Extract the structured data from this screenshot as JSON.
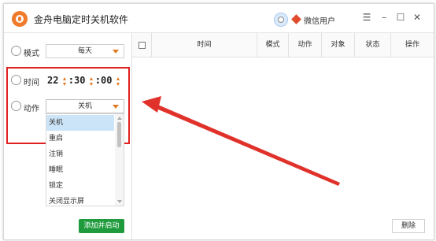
{
  "window": {
    "title": "金舟电脑定时关机软件",
    "user_name": "微信用户",
    "controls": {
      "menu": "☰",
      "minimize": "–",
      "maximize": "☐",
      "close": "✕"
    }
  },
  "left_panel": {
    "mode": {
      "label": "模式",
      "value": "每天"
    },
    "time": {
      "label": "时间",
      "hour": "22",
      "minute": "30",
      "second": "00"
    },
    "action": {
      "label": "动作",
      "value": "关机"
    },
    "action_options": [
      "关机",
      "重启",
      "注销",
      "睡眠",
      "锁定",
      "关闭显示屏"
    ],
    "selected_option_index": 0,
    "add_button": "添加并启动"
  },
  "table": {
    "columns": [
      "时间",
      "模式",
      "动作",
      "对象",
      "状态",
      "操作"
    ],
    "rows": [],
    "delete_button": "删除"
  },
  "colors": {
    "accent_orange": "#e07a20",
    "highlight_red": "#e02020",
    "button_green": "#1f9a3c",
    "selection_blue": "#cce4f7"
  }
}
